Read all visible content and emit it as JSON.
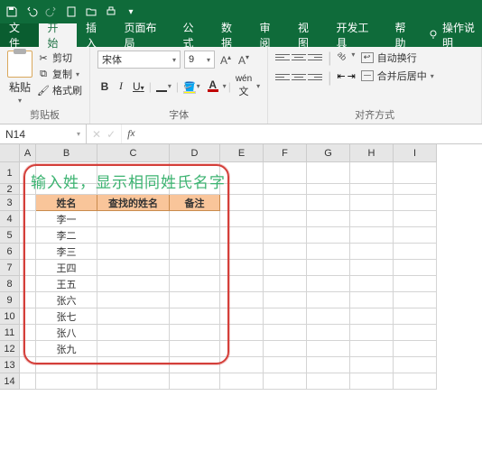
{
  "qat": {
    "save": "save-icon",
    "undo": "undo-icon",
    "redo": "redo-icon",
    "new": "new-icon",
    "open": "open-icon",
    "print": "print-icon"
  },
  "tabs": {
    "file": "文件",
    "home": "开始",
    "insert": "插入",
    "layout": "页面布局",
    "formulas": "公式",
    "data": "数据",
    "review": "审阅",
    "view": "视图",
    "dev": "开发工具",
    "help": "帮助",
    "tell": "操作说明"
  },
  "clipboard": {
    "paste": "粘贴",
    "cut": "剪切",
    "copy": "复制",
    "painter": "格式刷",
    "label": "剪贴板"
  },
  "font": {
    "name": "宋体",
    "size": "9",
    "label": "字体"
  },
  "align": {
    "wrap": "自动换行",
    "merge": "合并后居中",
    "label": "对齐方式"
  },
  "namebox": "N14",
  "title": "输入姓，显示相同姓氏名字",
  "headers": {
    "name": "姓名",
    "search": "查找的姓名",
    "note": "备注"
  },
  "names": [
    "李一",
    "李二",
    "李三",
    "王四",
    "王五",
    "张六",
    "张七",
    "张八",
    "张九"
  ],
  "cols": [
    "A",
    "B",
    "C",
    "D",
    "E",
    "F",
    "G",
    "H",
    "I"
  ]
}
